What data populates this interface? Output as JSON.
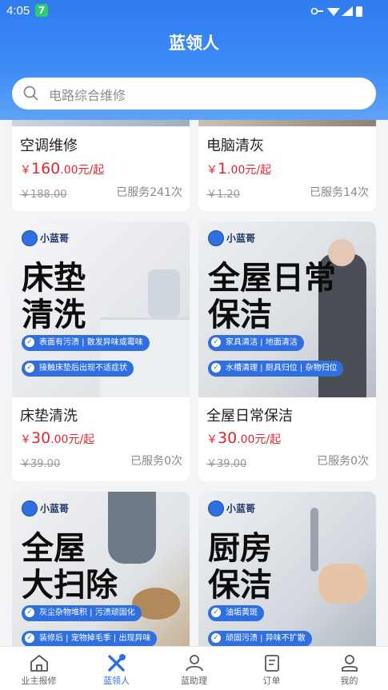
{
  "status_bar": {
    "time": "4:05",
    "badge": "7"
  },
  "header": {
    "title": "蓝领人"
  },
  "search": {
    "placeholder": "电路综合维修"
  },
  "services": [
    {
      "name": "空调维修",
      "currency": "￥",
      "price": "160",
      "price_decimals": ".00元/起",
      "original": "￥188.00",
      "served": "已服务241次"
    },
    {
      "name": "电脑清灰",
      "currency": "￥",
      "price": "1",
      "price_decimals": ".00元/起",
      "original": "￥1.20",
      "served": "已服务14次"
    },
    {
      "name": "床垫清洗",
      "currency": "￥",
      "price": "30",
      "price_decimals": ".00元/起",
      "original": "￥39.00",
      "served": "已服务0次",
      "image": {
        "brand": "小蓝哥",
        "headline1": "床垫",
        "headline2": "清洗",
        "tags": [
          "表面有污渍 | 散发异味或霉味",
          "接触床垫后出现不适症状"
        ]
      }
    },
    {
      "name": "全屋日常保洁",
      "currency": "￥",
      "price": "30",
      "price_decimals": ".00元/起",
      "original": "￥39.00",
      "served": "已服务0次",
      "image": {
        "brand": "小蓝哥",
        "headline1": "全屋日常",
        "headline2": "保洁",
        "tags": [
          "家具清洁 | 地面清洁",
          "水槽清理 | 厨具归位 | 杂物归位"
        ]
      }
    },
    {
      "image": {
        "brand": "小蓝哥",
        "headline1": "全屋",
        "headline2": "大扫除",
        "tags": [
          "灰尘杂物堆积 | 污渍顽固化",
          "装修后 | 宠物掉毛季 | 出现异味"
        ]
      }
    },
    {
      "image": {
        "brand": "小蓝哥",
        "headline1": "厨房",
        "headline2": "保洁",
        "tags": [
          "油垢黄斑",
          "顽固污渍 | 异味不扩散"
        ]
      }
    }
  ],
  "tabs": [
    {
      "label": "业主报修",
      "icon": "home-icon"
    },
    {
      "label": "蓝领人",
      "icon": "tools-icon"
    },
    {
      "label": "蓝助理",
      "icon": "person-icon"
    },
    {
      "label": "订单",
      "icon": "order-icon"
    },
    {
      "label": "我的",
      "icon": "user-icon"
    }
  ],
  "colors": {
    "brand": "#2f6fe0",
    "price": "#e5242f",
    "header": "#3b8bf5"
  }
}
